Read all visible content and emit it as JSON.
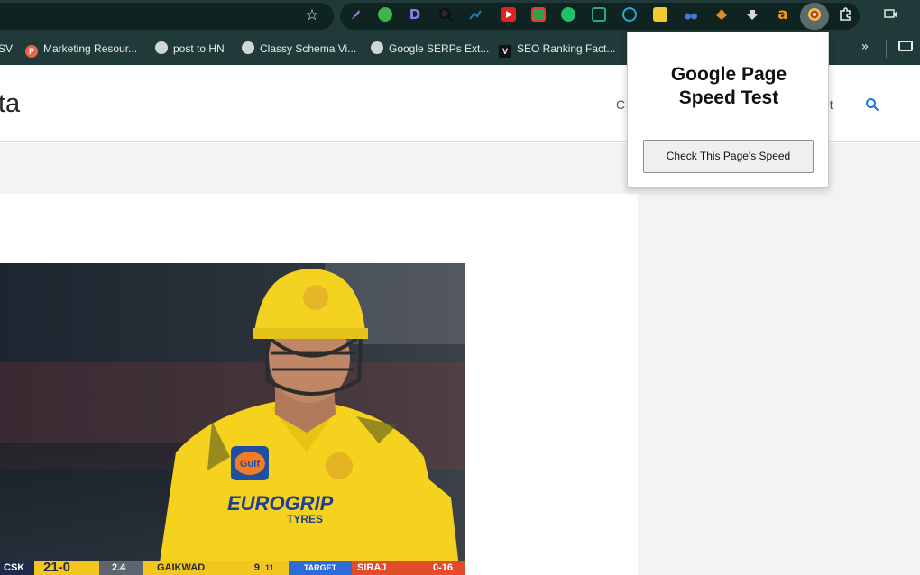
{
  "browser": {
    "bookmarks": [
      {
        "label": "SV",
        "icon": "globe-icon"
      },
      {
        "label": "Marketing Resour...",
        "icon": "p-icon",
        "color": "#e8664f"
      },
      {
        "label": "post to HN",
        "icon": "globe-icon"
      },
      {
        "label": "Classy Schema Vi...",
        "icon": "globe-icon"
      },
      {
        "label": "Google SERPs Ext...",
        "icon": "globe-icon"
      },
      {
        "label": "SEO Ranking Fact...",
        "icon": "v-icon"
      }
    ],
    "bookmark_p_letter": "P",
    "bookmark_v_letter": "V",
    "ext_d_letter": "D",
    "ext_a_letter": "a",
    "more_label": "»",
    "star_glyph": "☆"
  },
  "page": {
    "site_title_fragment": "ta",
    "nav_left_fragment": "C",
    "nav_right_fragment": "ot"
  },
  "scoreboard": {
    "team": "CSK",
    "score": "21-0",
    "overs": "2.4",
    "batter": "GAIKWAD",
    "batter_runs": "9",
    "batter_balls": "11",
    "target_label": "TARGET",
    "bowler": "SIRAJ",
    "bowler_figures": "0-16"
  },
  "jersey": {
    "sponsor": "EUROGRIP",
    "sponsor_sub": "TYRES",
    "logo_text": "Gulf"
  },
  "popup": {
    "title_line1": "Google Page",
    "title_line2": "Speed Test",
    "button_label": "Check This Page's Speed"
  },
  "colors": {
    "chrome_bg": "#1f3a38",
    "jersey_yellow": "#f5d21e",
    "link_blue": "#1a73e8"
  }
}
